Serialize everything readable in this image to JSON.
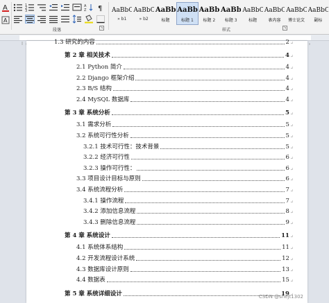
{
  "ribbon": {
    "paragraph_group_label": "段落",
    "styles_group_label": "样式",
    "launcher_glyph": "↘",
    "styles": [
      {
        "sample": "AaBbCc",
        "name": "» b1",
        "selected": false,
        "big": false
      },
      {
        "sample": "AaBbCcDc",
        "name": "» b2",
        "selected": false,
        "big": false
      },
      {
        "sample": "AaBbC",
        "name": "标题",
        "selected": false,
        "big": true
      },
      {
        "sample": "AaBbC",
        "name": "标题 1",
        "selected": true,
        "big": true
      },
      {
        "sample": "AaBbC",
        "name": "标题 2",
        "selected": false,
        "big": true
      },
      {
        "sample": "AaBbC",
        "name": "标题 3",
        "selected": false,
        "big": true
      },
      {
        "sample": "AaBbCcL",
        "name": "标题",
        "selected": false,
        "big": false
      },
      {
        "sample": "AaBbCcI",
        "name": "表内容",
        "selected": false,
        "big": false
      },
      {
        "sample": "AaBbCcI",
        "name": "博士论文",
        "selected": false,
        "big": false
      },
      {
        "sample": "AaBbC",
        "name": "副标",
        "selected": false,
        "big": false
      }
    ]
  },
  "toc": {
    "partial_entry": {
      "title": "1.3 研究的内容",
      "page": "2"
    },
    "entries": [
      {
        "title": "第 2 章  相关技术",
        "page": "4",
        "level": 1
      },
      {
        "title": "2.1 Python 简介",
        "page": "4",
        "level": 2
      },
      {
        "title": "2.2 Django 框架介绍",
        "page": "4",
        "level": 2
      },
      {
        "title": "2.3 B/S 结构",
        "page": "4",
        "level": 2
      },
      {
        "title": "2.4 MySQL 数据库",
        "page": "4",
        "level": 2
      },
      {
        "title": "第 3 章  系统分析",
        "page": "5",
        "level": 1
      },
      {
        "title": "3.1 需求分析",
        "page": "5",
        "level": 2
      },
      {
        "title": "3.2 系统可行性分析",
        "page": "5",
        "level": 2
      },
      {
        "title": "3.2.1 技术可行性：技术背景",
        "page": "5",
        "level": 3
      },
      {
        "title": "3.2.2 经济可行性",
        "page": "6",
        "level": 3
      },
      {
        "title": "3.2.3 操作可行性：",
        "page": "6",
        "level": 3
      },
      {
        "title": "3.3 项目设计目标与原则",
        "page": "6",
        "level": 2
      },
      {
        "title": "3.4 系统流程分析",
        "page": "7",
        "level": 2
      },
      {
        "title": "3.4.1 操作流程",
        "page": "7",
        "level": 3
      },
      {
        "title": "3.4.2 添加信息流程",
        "page": "8",
        "level": 3
      },
      {
        "title": "3.4.3 删除信息流程",
        "page": "9",
        "level": 3
      },
      {
        "title": "第 4 章  系统设计",
        "page": "11",
        "level": 1
      },
      {
        "title": "4.1  系统体系结构",
        "page": "11",
        "level": 2
      },
      {
        "title": "4.2 开发流程设计系统",
        "page": "12",
        "level": 2
      },
      {
        "title": "4.3  数据库设计原则",
        "page": "13",
        "level": 2
      },
      {
        "title": "4.4  数据表",
        "page": "15",
        "level": 2
      },
      {
        "title": "第 5 章  系统详细设计",
        "page": "19",
        "level": 1
      }
    ]
  },
  "paragraph_mark": "↵",
  "watermark": "CSDN @shejt1302"
}
